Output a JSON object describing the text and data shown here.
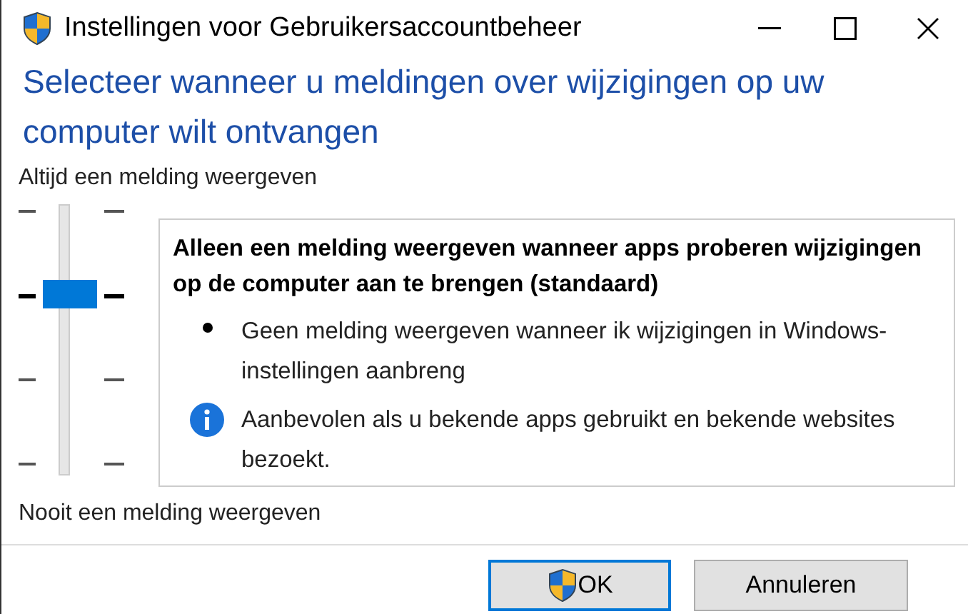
{
  "window": {
    "title": "Instellingen voor Gebruikersaccountbeheer"
  },
  "heading": "Selecteer wanneer u meldingen over wijzigingen op uw computer wilt ontvangen",
  "slider": {
    "top_label": "Altijd een melding weergeven",
    "bottom_label": "Nooit een melding weergeven",
    "level": 0.667
  },
  "description": {
    "title": "Alleen een melding weergeven wanneer apps proberen wijzigingen op de computer aan te brengen (standaard)",
    "points": [
      {
        "kind": "bullet",
        "text": "Geen melding weergeven wanneer ik wijzigingen in Windows-instellingen aanbreng"
      },
      {
        "kind": "info",
        "text": "Aanbevolen als u bekende apps gebruikt en bekende websites bezoekt."
      }
    ]
  },
  "buttons": [
    {
      "label": "OK",
      "kind": "shield",
      "default": true
    },
    {
      "label": "Annuleren",
      "kind": "plain",
      "default": false
    }
  ]
}
